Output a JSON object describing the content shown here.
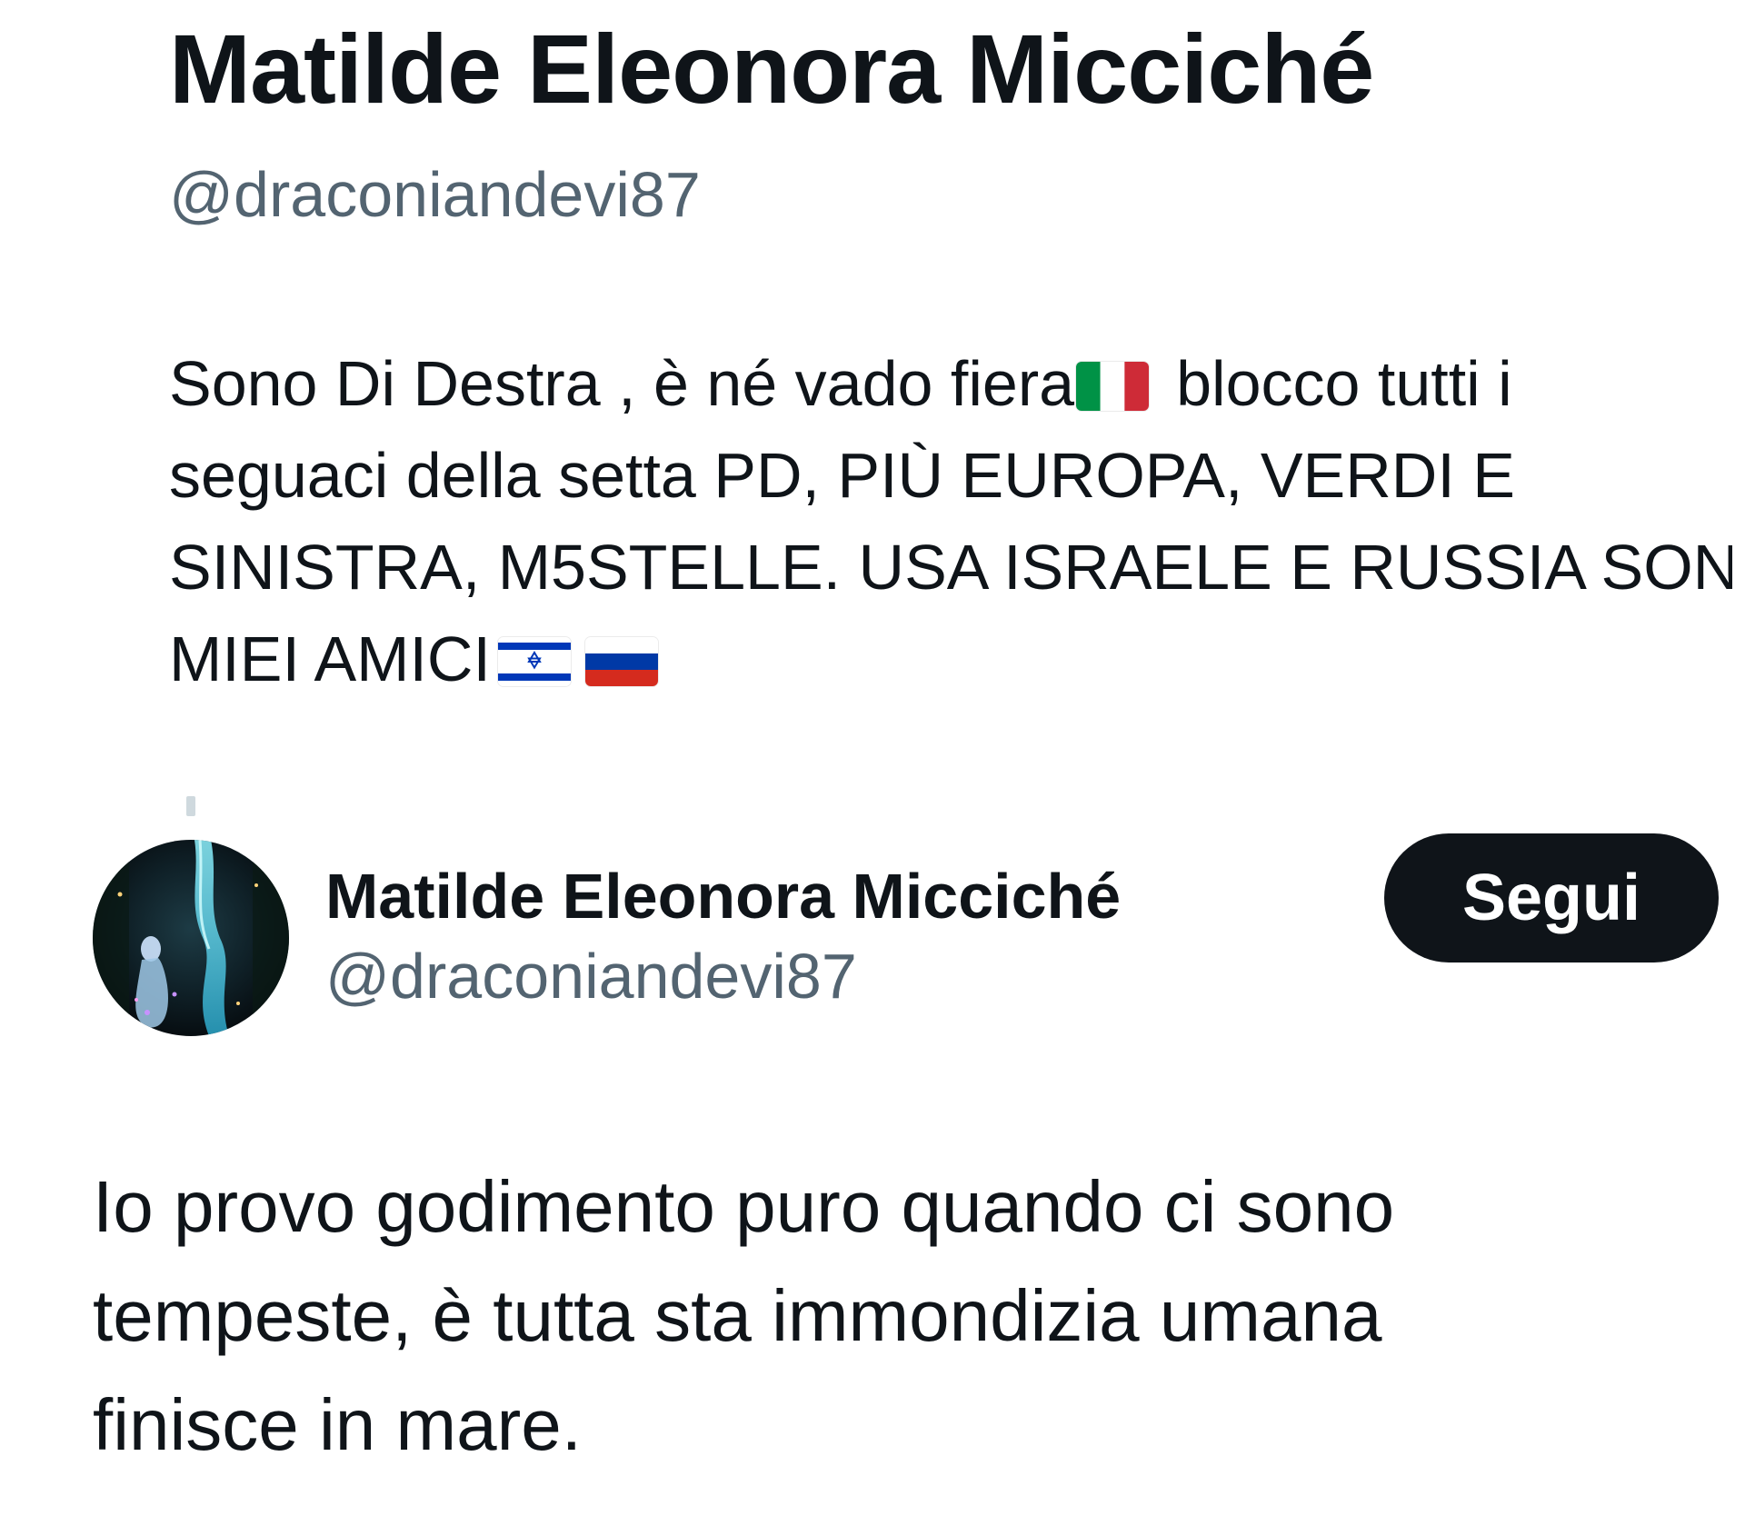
{
  "profile": {
    "display_name": "Matilde Eleonora Micciché",
    "handle": "@draconiandevi87",
    "bio_lines": [
      "Sono Di Destra , è né vado fiera",
      "blocco tutti i",
      "seguaci della setta PD, PIÙ EUROPA, VERDI E",
      "SINISTRA, M5STELLE. USA ISRAELE E RUSSIA SON",
      "MIEI AMICI"
    ],
    "bio_flags": [
      "flag-italy-icon",
      "flag-israel-icon",
      "flag-russia-icon"
    ]
  },
  "post": {
    "author_name": "Matilde Eleonora Micciché",
    "author_handle": "@draconiandevi87",
    "follow_label": "Segui",
    "text_lines": [
      "Io provo godimento puro quando ci sono",
      "tempeste, è tutta sta immondizia umana",
      "finisce in mare."
    ]
  },
  "colors": {
    "text_primary": "#0f1419",
    "text_secondary": "#536471",
    "button_bg": "#0f1419",
    "button_text": "#ffffff",
    "connector": "#cfd9de"
  }
}
